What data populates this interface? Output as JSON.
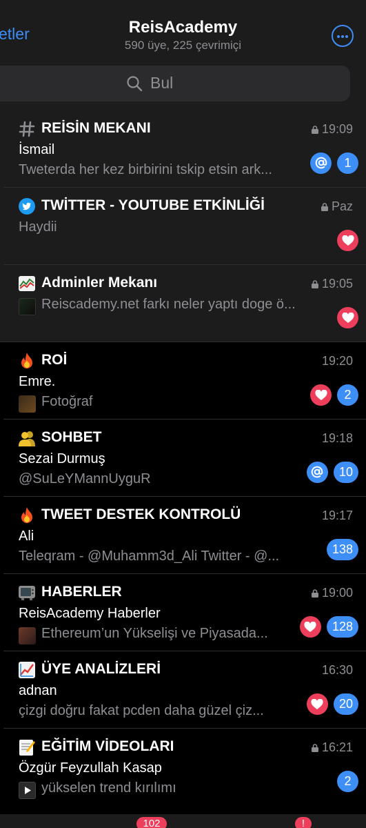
{
  "header": {
    "back_label": "etler",
    "title": "ReisAcademy",
    "subtitle": "590 üye, 225 çevrimiçi",
    "search_placeholder": "Bul"
  },
  "colors": {
    "accent": "#3e8ef7",
    "heart_badge": "#ed3f5c",
    "pinned_bg": "#1c1c1d",
    "bg": "#000000",
    "muted_text": "#8e8e93"
  },
  "topics": [
    {
      "icon": "hashtag-icon",
      "title": "REİSİN MEKANI",
      "time": "19:09",
      "locked": true,
      "pinned": true,
      "sender": "İsmail",
      "preview": "Tweterda her kez birbirini tskip etsin ark...",
      "mention": true,
      "reaction": false,
      "count": "1"
    },
    {
      "icon": "twitter-bird-icon",
      "title": "TWİTTER - YOUTUBE ETKİNLİĞİ",
      "time": "Paz",
      "locked": true,
      "pinned": true,
      "sender": "",
      "preview": "Haydii",
      "mention": false,
      "reaction": true,
      "count": ""
    },
    {
      "icon": "chart-emoji-icon",
      "title": "Adminler Mekanı",
      "time": "19:05",
      "locked": true,
      "pinned": true,
      "sender": "",
      "preview": "Reiscademy.net farkı neler yaptı doge ö...",
      "thumb": true,
      "mention": false,
      "reaction": true,
      "count": ""
    },
    {
      "icon": "fire-emoji-icon",
      "title": "ROİ",
      "time": "19:20",
      "locked": false,
      "pinned": false,
      "sender": "Emre.",
      "preview": "Fotoğraf",
      "thumb": true,
      "mention": false,
      "reaction": true,
      "count": "2"
    },
    {
      "icon": "people-emoji-icon",
      "title": "SOHBET",
      "time": "19:18",
      "locked": false,
      "pinned": false,
      "sender": "Sezai Durmuş",
      "preview": "@SuLeYMannUyguR",
      "mention": true,
      "reaction": false,
      "count": "10"
    },
    {
      "icon": "fire-emoji-icon",
      "title": "TWEET DESTEK KONTROLÜ",
      "time": "19:17",
      "locked": false,
      "pinned": false,
      "sender": "Ali",
      "preview": "Teleqram - @Muhamm3d_Ali Twitter - @...",
      "mention": false,
      "reaction": false,
      "count": "138"
    },
    {
      "icon": "tv-emoji-icon",
      "title": "HABERLER",
      "time": "19:00",
      "locked": true,
      "pinned": false,
      "sender": "ReisAcademy Haberler",
      "preview": "Ethereum’un Yükselişi ve Piyasada...",
      "thumb": true,
      "mention": false,
      "reaction": true,
      "count": "128"
    },
    {
      "icon": "chart-up-emoji-icon",
      "title": "ÜYE ANALİZLERİ",
      "time": "16:30",
      "locked": false,
      "pinned": false,
      "sender": "adnan",
      "preview": "çizgi doğru fakat pcden daha güzel çiz...",
      "mention": false,
      "reaction": true,
      "count": "20"
    },
    {
      "icon": "memo-emoji-icon",
      "title": "EĞİTİM VİDEOLARI",
      "time": "16:21",
      "locked": true,
      "pinned": false,
      "sender": "Özgür Feyzullah Kasap",
      "preview": "yükselen trend kırılımı",
      "thumb": true,
      "mention": false,
      "reaction": false,
      "count": "2"
    }
  ],
  "tabbar": {
    "chats_badge": "102",
    "settings_badge": "!"
  }
}
